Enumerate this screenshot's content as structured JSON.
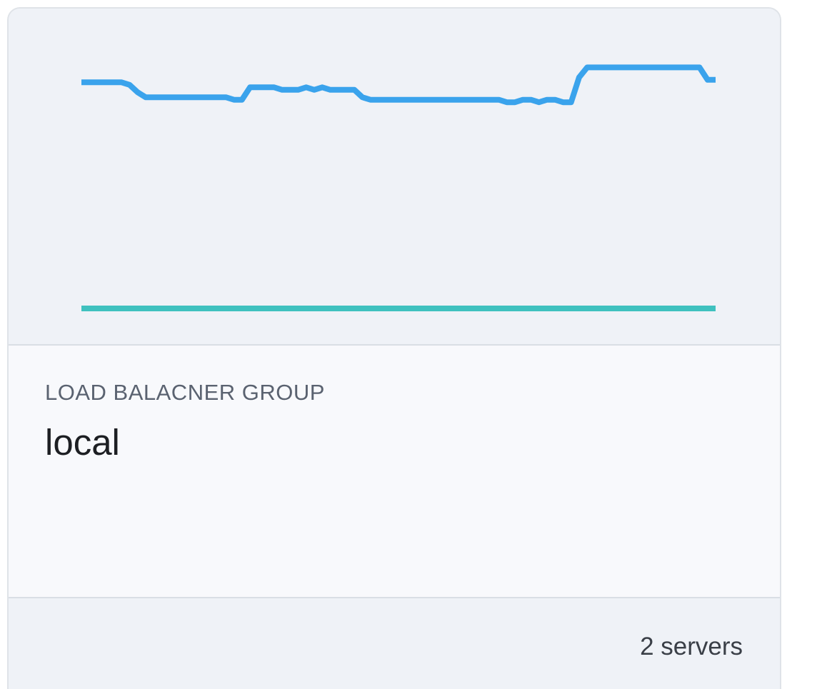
{
  "card": {
    "eyebrow": "LOAD BALACNER GROUP",
    "title": "local",
    "footer_text": "2 servers"
  },
  "colors": {
    "card_bg": "#eff2f7",
    "info_bg": "#f8f9fc",
    "series_a": "#3aa3ec",
    "series_b": "#3fc1bf"
  },
  "chart_data": {
    "type": "line",
    "title": "",
    "xlabel": "",
    "ylabel": "",
    "grid": false,
    "legend": "none",
    "ylim": [
      0,
      100
    ],
    "x": [
      0,
      1,
      2,
      3,
      4,
      5,
      6,
      7,
      8,
      9,
      10,
      11,
      12,
      13,
      14,
      15,
      16,
      17,
      18,
      19,
      20,
      21,
      22,
      23,
      24,
      25,
      26,
      27,
      28,
      29,
      30,
      31,
      32,
      33,
      34,
      35,
      36,
      37,
      38,
      39,
      40,
      41,
      42,
      43,
      44,
      45,
      46,
      47,
      48,
      49,
      50,
      51,
      52,
      53,
      54,
      55,
      56,
      57,
      58,
      59,
      60,
      61,
      62,
      63,
      64,
      65,
      66,
      67,
      68,
      69,
      70,
      71,
      72,
      73,
      74,
      75,
      76,
      77,
      78,
      79
    ],
    "series": [
      {
        "color": "#3aa3ec",
        "values": [
          91,
          91,
          91,
          91,
          91,
          91,
          90,
          87,
          85,
          85,
          85,
          85,
          85,
          85,
          85,
          85,
          85,
          85,
          85,
          84,
          84,
          89,
          89,
          89,
          89,
          88,
          88,
          88,
          89,
          88,
          89,
          88,
          88,
          88,
          88,
          85,
          84,
          84,
          84,
          84,
          84,
          84,
          84,
          84,
          84,
          84,
          84,
          84,
          84,
          84,
          84,
          84,
          84,
          83,
          83,
          84,
          84,
          83,
          84,
          84,
          83,
          83,
          93,
          97,
          97,
          97,
          97,
          97,
          97,
          97,
          97,
          97,
          97,
          97,
          97,
          97,
          97,
          97,
          92,
          92
        ]
      },
      {
        "color": "#3fc1bf",
        "values": [
          0,
          0,
          0,
          0,
          0,
          0,
          0,
          0,
          0,
          0,
          0,
          0,
          0,
          0,
          0,
          0,
          0,
          0,
          0,
          0,
          0,
          0,
          0,
          0,
          0,
          0,
          0,
          0,
          0,
          0,
          0,
          0,
          0,
          0,
          0,
          0,
          0,
          0,
          0,
          0,
          0,
          0,
          0,
          0,
          0,
          0,
          0,
          0,
          0,
          0,
          0,
          0,
          0,
          0,
          0,
          0,
          0,
          0,
          0,
          0,
          0,
          0,
          0,
          0,
          0,
          0,
          0,
          0,
          0,
          0,
          0,
          0,
          0,
          0,
          0,
          0,
          0,
          0,
          0,
          0
        ]
      }
    ]
  }
}
